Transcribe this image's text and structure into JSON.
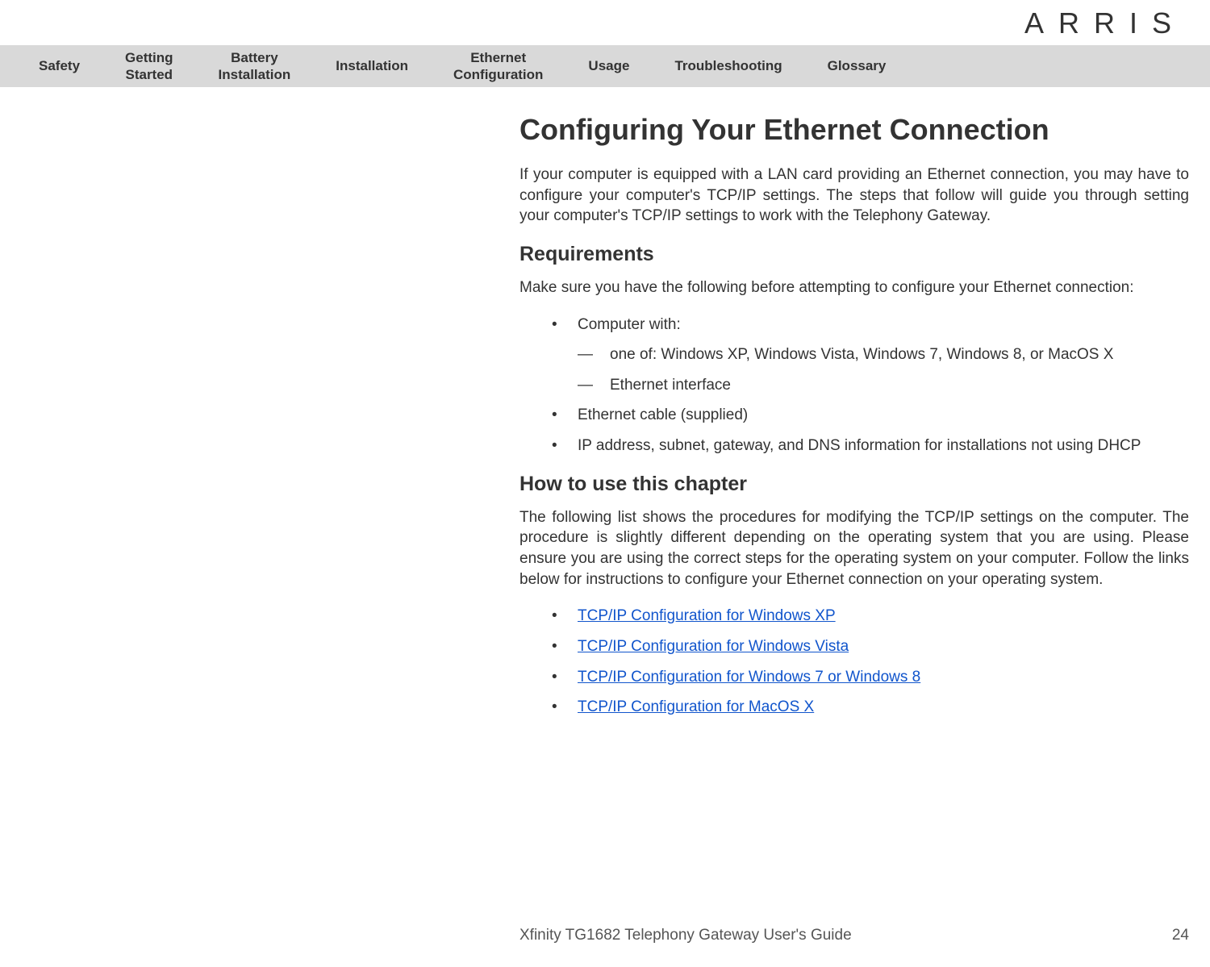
{
  "logo": "ARRIS",
  "nav": [
    "Safety",
    "Getting\nStarted",
    "Battery\nInstallation",
    "Installation",
    "Ethernet\nConfiguration",
    "Usage",
    "Troubleshooting",
    "Glossary"
  ],
  "title": "Configuring Your Ethernet Connection",
  "intro": "If your computer is equipped with a LAN card providing an Ethernet connection, you may have to configure your computer's TCP/IP settings. The steps that follow will guide you through setting your computer's TCP/IP settings to work with the Telephony Gateway.",
  "req_heading": "Requirements",
  "req_intro": "Make sure you have the following before attempting to configure your Ethernet connection:",
  "req": {
    "item1": "Computer with:",
    "sub1": "one of: Windows XP, Windows Vista, Windows 7, Windows 8, or MacOS X",
    "sub2": "Ethernet interface",
    "item2": "Ethernet cable (supplied)",
    "item3": "IP address, subnet, gateway, and DNS information for installations not using DHCP"
  },
  "how_heading": "How to use this chapter",
  "how_intro": "The following list shows the procedures for modifying the TCP/IP settings on the computer. The procedure is slightly different depending on the operating system that you are using. Please ensure you are using the correct steps for the operating system on your computer. Follow the links below for instructions to configure your Ethernet connection on your operating system.",
  "links": [
    "TCP/IP Configuration for Windows XP",
    "TCP/IP Configuration for Windows Vista",
    "TCP/IP Configuration for Windows 7 or Windows 8",
    "TCP/IP Configuration for MacOS X"
  ],
  "footer_title": "Xfinity TG1682 Telephony Gateway User's Guide",
  "page_number": "24"
}
